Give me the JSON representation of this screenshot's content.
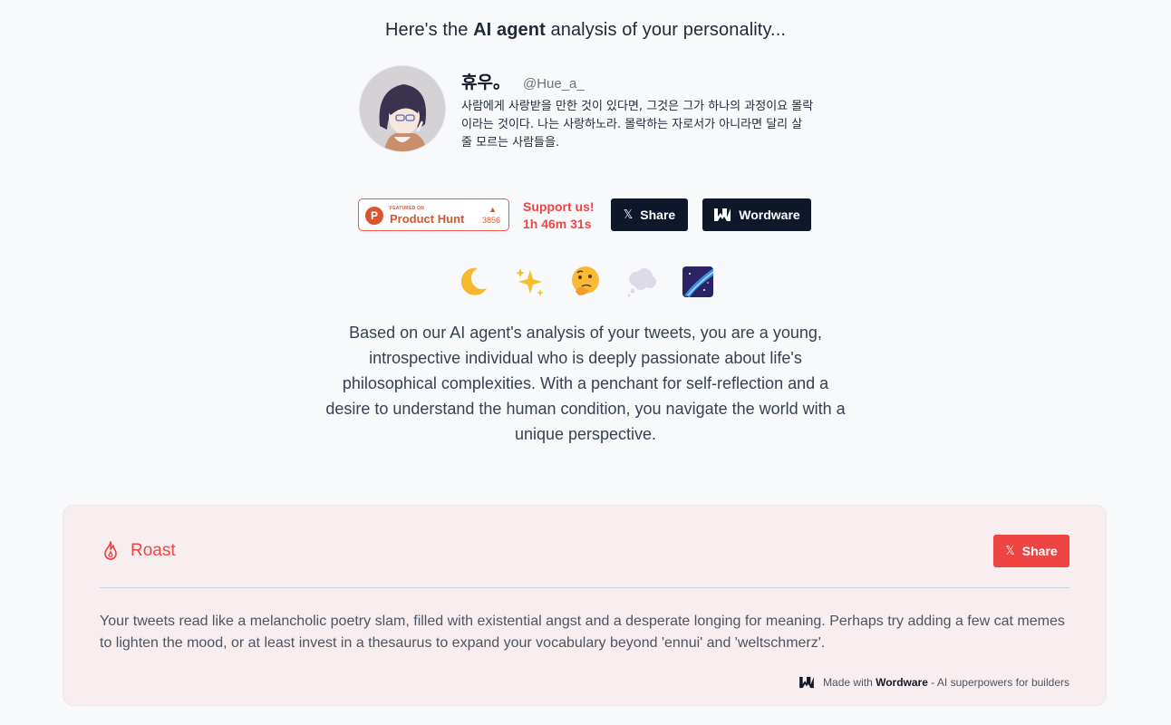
{
  "header": {
    "prefix": "Here's the",
    "emphasis": "AI agent",
    "suffix": "analysis of your personality..."
  },
  "profile": {
    "name": "휴우。",
    "handle": "@Hue_a_",
    "bio": "사람에게 사랑받을 만한 것이 있다면, 그것은 그가 하나의 과정이요 몰락이라는 것이다. 나는 사랑하노라. 몰락하는 자로서가 아니라면 달리 살 줄 모르는 사람들을."
  },
  "actions": {
    "producthunt": {
      "featured": "FEATURED ON",
      "title": "Product Hunt",
      "votes": "3856"
    },
    "support_label": "Support us!",
    "countdown": "1h 46m 31s",
    "share_label": "Share",
    "wordware_label": "Wordware"
  },
  "emojis": [
    "crescent-moon",
    "sparkles",
    "thinking-face",
    "thought-balloon",
    "milky-way"
  ],
  "summary": "Based on our AI agent's analysis of your tweets, you are a young, introspective individual who is deeply passionate about life's philosophical complexities. With a penchant for self-reflection and a desire to understand the human condition, you navigate the world with a unique perspective.",
  "roast": {
    "title": "Roast",
    "share_label": "Share",
    "text": "Your tweets read like a melancholic poetry slam, filled with existential angst and a desperate longing for meaning. Perhaps try adding a few cat memes to lighten the mood, or at least invest in a thesaurus to expand your vocabulary beyond 'ennui' and 'weltschmerz'.",
    "footer_prefix": "Made with",
    "footer_brand": "Wordware",
    "footer_suffix": "- AI superpowers for builders"
  },
  "colors": {
    "accent_red": "#ef4444",
    "dark_button": "#0f172a",
    "card_bg": "#f8eeef",
    "producthunt": "#da552f"
  }
}
